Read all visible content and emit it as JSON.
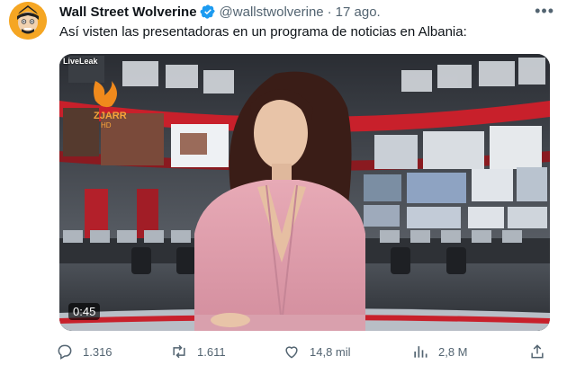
{
  "author": {
    "name": "Wall Street Wolverine",
    "handle": "@wallstwolverine",
    "separator": "·",
    "date": "17 ago."
  },
  "tweet_text": "Así visten las presentadoras en un programa de noticias en Albania:",
  "media": {
    "watermark": "LiveLeak",
    "channel_logo_text": "ZJARR",
    "channel_logo_sub": "HD",
    "duration": "0:45"
  },
  "actions": {
    "replies": "1.316",
    "retweets": "1.611",
    "likes": "14,8 mil",
    "views": "2,8 M"
  },
  "colors": {
    "verified": "#1d9bf0",
    "muted_text": "#536471",
    "avatar_bg": "#f5a623",
    "studio_red": "#c8202b"
  },
  "icons": [
    "more-options-icon",
    "verified-badge-icon",
    "reply-icon",
    "retweet-icon",
    "like-icon",
    "views-icon",
    "share-icon"
  ]
}
